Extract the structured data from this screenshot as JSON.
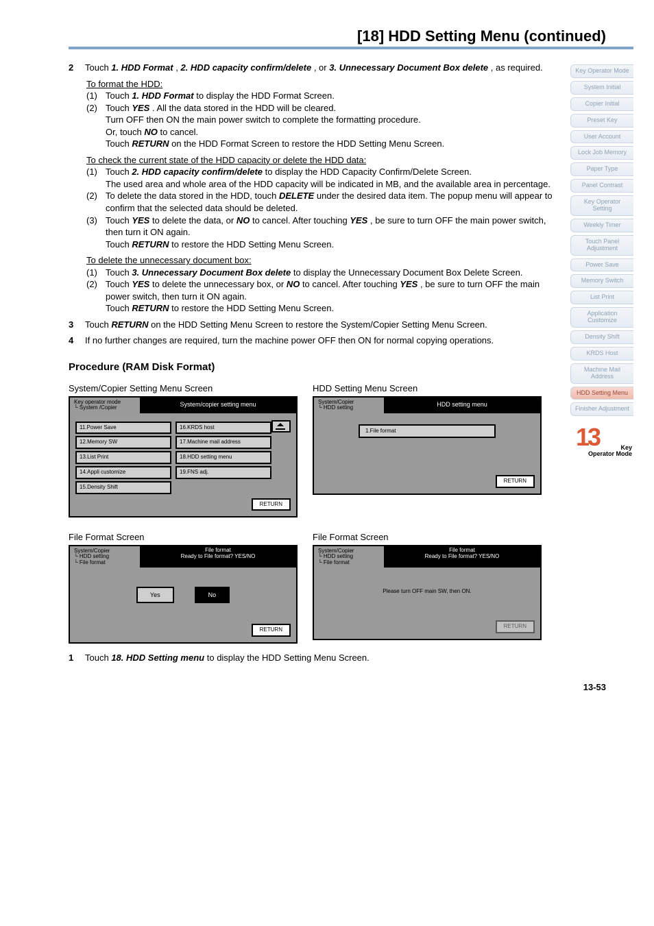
{
  "page": {
    "title": "[18] HDD Setting Menu (continued)",
    "footer": "13-53"
  },
  "steps": {
    "s2": {
      "num": "2",
      "intro_pre": "Touch ",
      "intro_b1": "1. HDD Format",
      "intro_mid1": ", ",
      "intro_b2": "2. HDD capacity confirm/delete",
      "intro_mid2": ", or ",
      "intro_b3": "3. Unnecessary Document Box delete",
      "intro_post": ", as required.",
      "h1": "To format the HDD:",
      "a1n": "(1)",
      "a1_pre": "Touch ",
      "a1_b": "1. HDD Format",
      "a1_post": " to display the HDD Format Screen.",
      "a2n": "(2)",
      "a2_pre": "Touch ",
      "a2_b": "YES",
      "a2_post": ". All the data stored in the HDD will be cleared.",
      "a2_l2": "Turn OFF then ON the main power switch to complete the formatting procedure.",
      "a2_l3_pre": "Or, touch ",
      "a2_l3_b": "NO",
      "a2_l3_post": " to cancel.",
      "a2_l4_pre": "Touch ",
      "a2_l4_b": "RETURN",
      "a2_l4_post": " on the HDD Format Screen to restore the HDD Setting Menu Screen.",
      "h2": "To check the current state of the HDD capacity or delete the HDD data:",
      "b1n": "(1)",
      "b1_pre": "Touch ",
      "b1_b": "2. HDD capacity confirm/delete",
      "b1_post": " to display the HDD Capacity Confirm/Delete Screen.",
      "b1_l2": "The used area and whole area of the HDD capacity will be indicated in MB, and the available area in percentage.",
      "b2n": "(2)",
      "b2_pre": "To delete the data stored in the HDD, touch ",
      "b2_b": "DELETE",
      "b2_post": " under the desired data item. The popup menu will appear to confirm that the selected data should be deleted.",
      "b3n": "(3)",
      "b3_pre": "Touch ",
      "b3_b1": "YES",
      "b3_mid": " to delete the data, or ",
      "b3_b2": "NO",
      "b3_mid2": " to cancel. After touching ",
      "b3_b3": "YES",
      "b3_post": ", be sure to turn OFF the main power switch, then turn it ON again.",
      "b3_l2_pre": "Touch ",
      "b3_l2_b": "RETURN",
      "b3_l2_post": " to restore the HDD Setting Menu Screen.",
      "h3": "To delete the unnecessary document box:",
      "c1n": "(1)",
      "c1_pre": "Touch ",
      "c1_b": "3. Unnecessary Document Box delete",
      "c1_post": " to display the Unnecessary Document Box Delete Screen.",
      "c2n": "(2)",
      "c2_pre": "Touch ",
      "c2_b1": "YES",
      "c2_mid": " to delete the unnecessary box, or ",
      "c2_b2": "NO",
      "c2_mid2": " to cancel. After touching ",
      "c2_b3": "YES",
      "c2_post": ", be sure to turn OFF the main power switch, then turn it ON again.",
      "c2_l2_pre": "Touch ",
      "c2_l2_b": "RETURN",
      "c2_l2_post": " to restore the HDD Setting Menu Screen."
    },
    "s3": {
      "num": "3",
      "pre": "Touch ",
      "b": "RETURN",
      "post": " on the HDD Setting Menu Screen to restore the System/Copier Setting Menu Screen."
    },
    "s4": {
      "num": "4",
      "text": "If no further changes are required, turn the machine power OFF then ON for normal copying operations."
    }
  },
  "procedure": {
    "heading": "Procedure (RAM Disk Format)",
    "left_label": "System/Copier Setting Menu Screen",
    "right_label": "HDD Setting Menu Screen",
    "left2_label": "File Format Screen",
    "right2_label": "File Format Screen"
  },
  "ui1": {
    "crumb1": "Key operator mode",
    "crumb2": "└ System /Copier",
    "title": "System/copier setting menu",
    "items": [
      "11.Power Save",
      "12.Memory SW",
      "13.List Print",
      "14.Appli customize",
      "15.Density Shift",
      "16.KRDS host",
      "17.Machine mail address",
      "18.HDD setting menu",
      "19.FNS adj."
    ],
    "return": "RETURN"
  },
  "ui2": {
    "crumb1": "System/Copier",
    "crumb2": "└ HDD setting",
    "title": "HDD setting menu",
    "item": "1.File format",
    "return": "RETURN"
  },
  "ui3": {
    "crumb1": "System/Copier",
    "crumb2": "└ HDD setting",
    "crumb3": "  └ File format",
    "title1": "File format",
    "title2": "Ready to File format? YES/NO",
    "yes": "Yes",
    "no": "No",
    "return": "RETURN"
  },
  "ui4": {
    "crumb1": "System/Copier",
    "crumb2": "└ HDD setting",
    "crumb3": "  └ File format",
    "title1": "File format",
    "title2": "Ready to File format? YES/NO",
    "msg": "Please turn OFF main SW, then ON.",
    "return": "RETURN"
  },
  "final": {
    "num": "1",
    "pre": "Touch ",
    "b": "18. HDD Setting menu",
    "post": " to display the HDD Setting Menu Screen."
  },
  "sidebar": {
    "items": [
      "Key Operator Mode",
      "System Initial",
      "Copier Initial",
      "Preset Key",
      "User Account",
      "Lock Job Memory",
      "Paper Type",
      "Panel Contrast",
      "Key Operator Setting",
      "Weekly Timer",
      "Touch Panel Adjustment",
      "Power Save",
      "Memory Switch",
      "List Print",
      "Application Customize",
      "Density Shift",
      "KRDS Host",
      "Machine Mail Address",
      "HDD Setting Menu",
      "Finisher Adjustment"
    ],
    "active_index": 18,
    "ch_num": "13",
    "ch_text": "Key Operator Mode"
  }
}
